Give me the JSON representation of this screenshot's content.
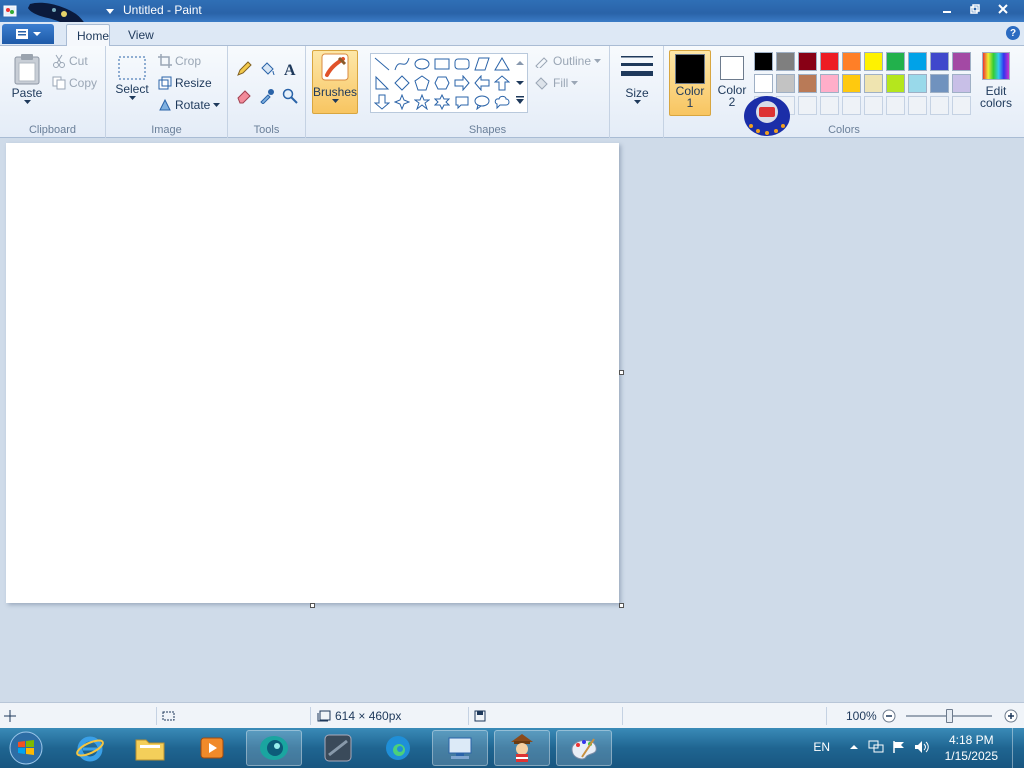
{
  "window": {
    "title": "Untitled - Paint"
  },
  "tabs": [
    {
      "label": "Home"
    },
    {
      "label": "View"
    }
  ],
  "clipboard": {
    "paste": "Paste",
    "cut": "Cut",
    "copy": "Copy",
    "label": "Clipboard"
  },
  "image": {
    "select": "Select",
    "crop": "Crop",
    "resize": "Resize",
    "rotate": "Rotate",
    "label": "Image"
  },
  "tools": {
    "label": "Tools"
  },
  "brushes": {
    "label": "Brushes"
  },
  "shapes": {
    "label": "Shapes",
    "outline": "Outline",
    "fill": "Fill"
  },
  "size": {
    "label": "Size"
  },
  "colors": {
    "label": "Colors",
    "color1": "Color",
    "color1_num": "1",
    "color2": "Color",
    "color2_num": "2",
    "edit": "Edit",
    "edit2": "colors",
    "color1_value": "#000000",
    "color2_value": "#ffffff",
    "palette": [
      "#000000",
      "#7f7f7f",
      "#880015",
      "#ed1c24",
      "#ff7f27",
      "#fff200",
      "#22b14c",
      "#00a2e8",
      "#3f48cc",
      "#a349a4",
      "#ffffff",
      "#c3c3c3",
      "#b97a57",
      "#ffaec9",
      "#ffc90e",
      "#efe4b0",
      "#b5e61d",
      "#99d9ea",
      "#7092be",
      "#c8bfe7"
    ]
  },
  "status": {
    "dimensions": "614 × 460px",
    "zoom": "100%"
  },
  "taskbar": {
    "lang": "EN",
    "time": "4:18 PM",
    "date": "1/15/2025"
  }
}
